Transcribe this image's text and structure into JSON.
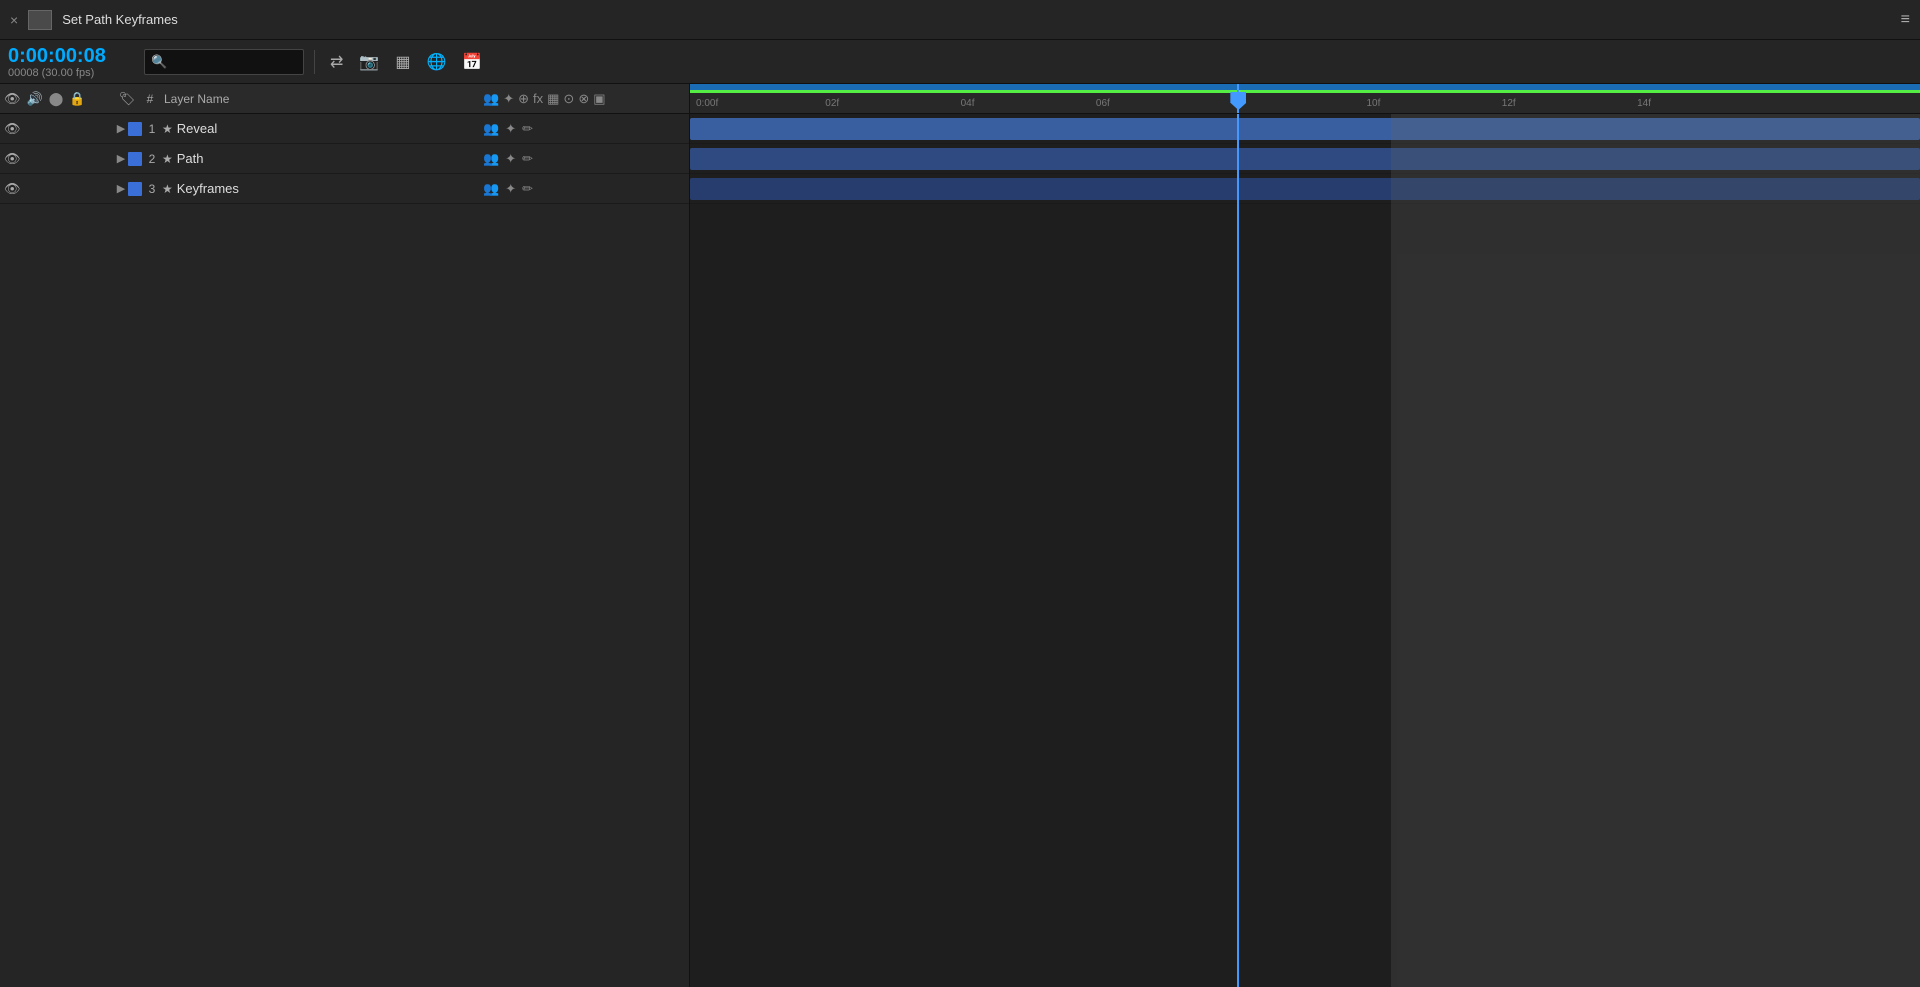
{
  "header": {
    "title": "Set Path Keyframes",
    "menu_icon": "≡",
    "close_label": "×"
  },
  "toolbar": {
    "time_current": "0:00:00:08",
    "time_frames": "00008 (30.00 fps)",
    "search_placeholder": "🔍",
    "btn_icons": [
      "⇄",
      "📷",
      "▦",
      "🌐",
      "📅"
    ]
  },
  "columns": {
    "visibility_icons": [
      "👁",
      "🔊",
      "⬤",
      "🔒"
    ],
    "tag_icon": "🏷",
    "num_label": "#",
    "name_label": "Layer Name",
    "control_icons": [
      "👥",
      "✦",
      "✦",
      "fx",
      "▦",
      "⊙",
      "⊗",
      "▣"
    ]
  },
  "layers": [
    {
      "id": 1,
      "number": "1",
      "name": "Reveal",
      "color": "#3a6fd8",
      "ctrl_icons": [
        "👥",
        "✦",
        "✏"
      ]
    },
    {
      "id": 2,
      "number": "2",
      "name": "Path",
      "color": "#3a6fd8",
      "ctrl_icons": [
        "👥",
        "✦",
        "✏"
      ]
    },
    {
      "id": 3,
      "number": "3",
      "name": "Keyframes",
      "color": "#3a6fd8",
      "ctrl_icons": [
        "👥",
        "✦",
        "✏"
      ]
    }
  ],
  "timeline": {
    "ruler_marks": [
      {
        "label": "0:00f",
        "offset_pct": 0.8
      },
      {
        "label": "02f",
        "offset_pct": 9.0
      },
      {
        "label": "04f",
        "offset_pct": 17.5
      },
      {
        "label": "06f",
        "offset_pct": 26.0
      },
      {
        "label": "10f",
        "offset_pct": 43.5
      },
      {
        "label": "12f",
        "offset_pct": 52.0
      },
      {
        "label": "14f",
        "offset_pct": 60.5
      }
    ],
    "playhead_pct": 35.5,
    "work_area_end_pct": 60.0,
    "tracks": [
      {
        "color": "#3a5fa0",
        "left_pct": 0,
        "right_pct": 100
      },
      {
        "color": "#2e4a80",
        "left_pct": 0,
        "right_pct": 100
      },
      {
        "color": "#2b4575",
        "left_pct": 0,
        "right_pct": 100
      }
    ]
  }
}
